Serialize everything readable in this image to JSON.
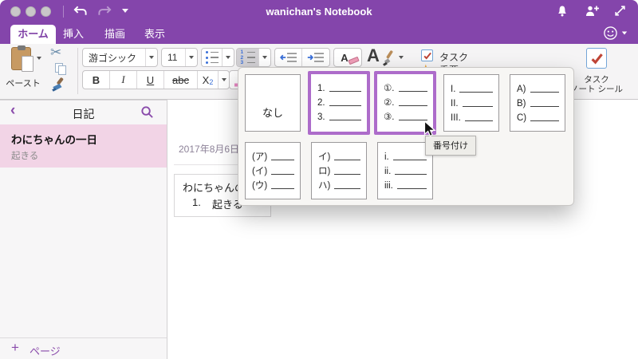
{
  "titlebar": {
    "window_title": "wanichan's Notebook"
  },
  "tabs": [
    {
      "label": "ホーム",
      "active": true
    },
    {
      "label": "挿入",
      "active": false
    },
    {
      "label": "描画",
      "active": false
    },
    {
      "label": "表示",
      "active": false
    }
  ],
  "ribbon": {
    "paste": {
      "label": "ペースト"
    },
    "font": {
      "name": "游ゴシック",
      "size": "11"
    },
    "format": {
      "bold": "B",
      "italic": "I",
      "underline": "U",
      "strikethrough": "abc",
      "subscript_base": "X",
      "subscript_sub": "2"
    },
    "tags": {
      "task": "タスク",
      "important": "重要"
    },
    "task_seal": {
      "line1": "タスク",
      "line2": "ノート シール"
    }
  },
  "sidebar": {
    "section_title": "日記",
    "pages": [
      {
        "title": "わにちゃんの一日",
        "preview": "起きる",
        "selected": true
      }
    ],
    "add_page": {
      "label": "ページ"
    }
  },
  "page": {
    "date": "2017年8月6日",
    "note": {
      "title": "わにちゃんの一日",
      "list": [
        {
          "number": "1.",
          "text": "起きる"
        }
      ]
    }
  },
  "numbering_gallery": {
    "tooltip": "番号付け",
    "rows": [
      [
        {
          "name": "none",
          "label": "なし",
          "state": "normal"
        },
        {
          "name": "decimal",
          "labels": [
            "1.",
            "2.",
            "3."
          ],
          "state": "selected"
        },
        {
          "name": "circled",
          "labels": [
            "①.",
            "②.",
            "③."
          ],
          "state": "hover"
        },
        {
          "name": "roman-upper",
          "labels": [
            "I.",
            "II.",
            "III."
          ],
          "state": "normal"
        },
        {
          "name": "alpha-paren",
          "labels": [
            "A)",
            "B)",
            "C)"
          ],
          "state": "normal"
        }
      ],
      [
        {
          "name": "katakana-fullparen",
          "labels": [
            "(ア)",
            "(イ)",
            "(ウ)"
          ],
          "state": "normal"
        },
        {
          "name": "katakana-paren",
          "labels": [
            "イ)",
            "ロ)",
            "ハ)"
          ],
          "state": "normal"
        },
        {
          "name": "roman-lower",
          "labels": [
            "i.",
            "ii.",
            "iii."
          ],
          "state": "normal"
        }
      ]
    ]
  },
  "colors": {
    "accent_purple": "#8445ab",
    "selection_purple": "#ad6cca",
    "sidebar_selected_pink": "#f2d4e6",
    "task_check_red": "#bf4536"
  }
}
